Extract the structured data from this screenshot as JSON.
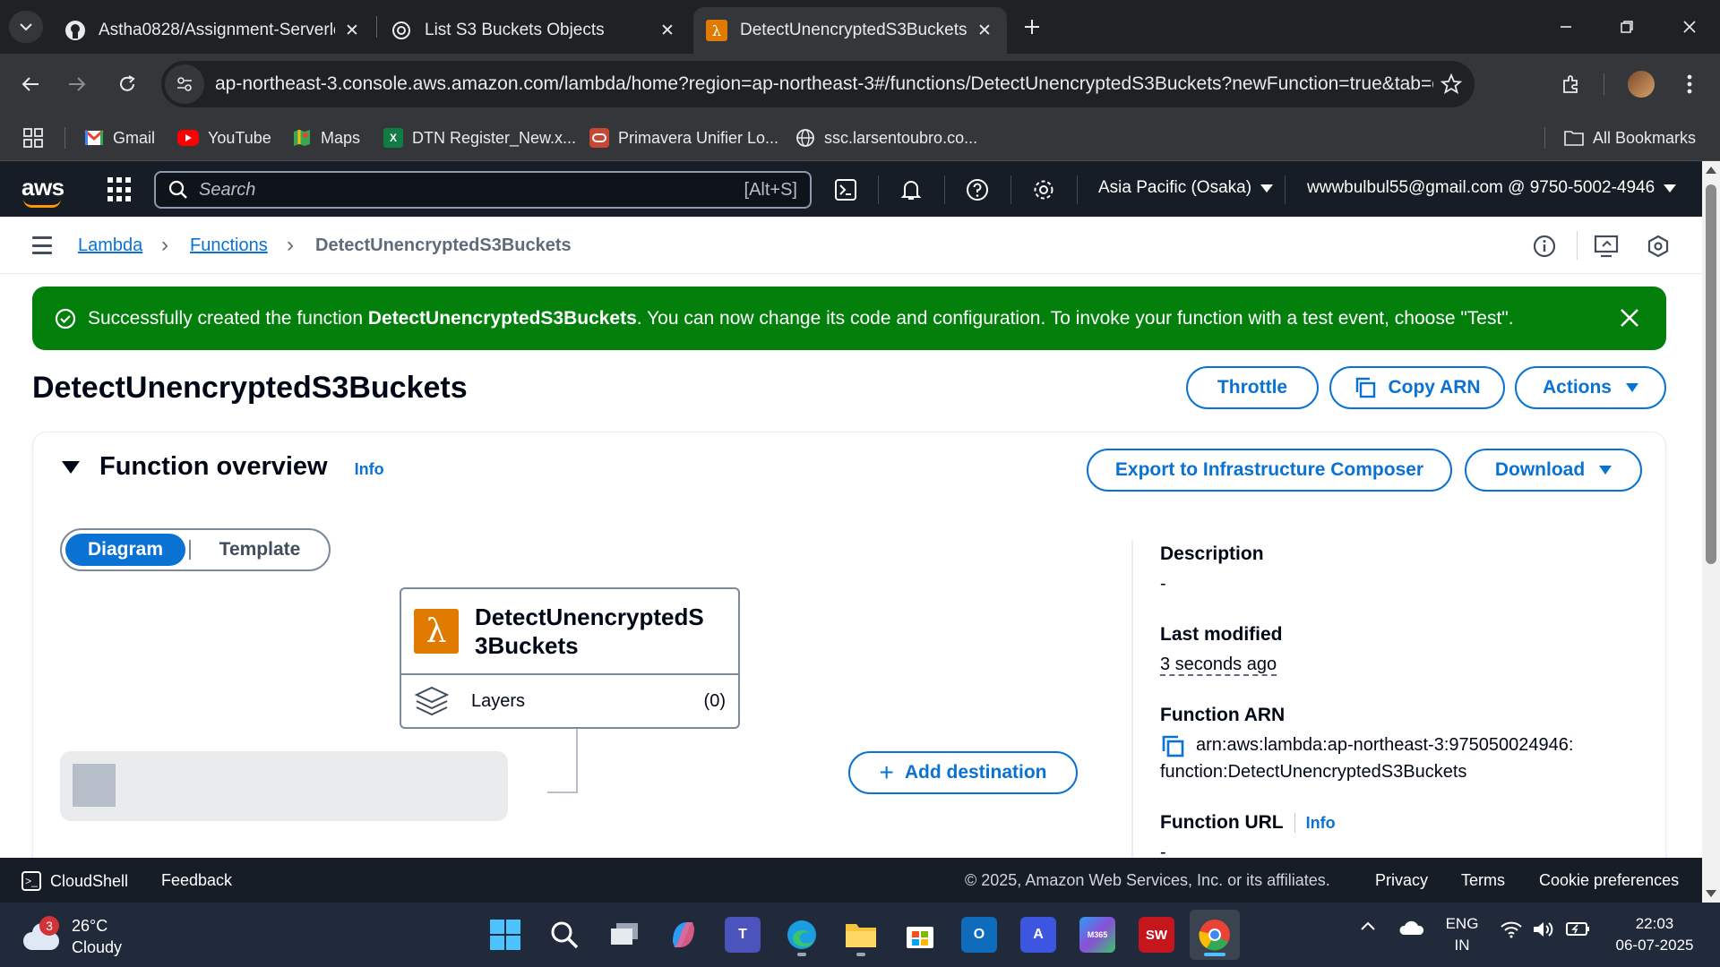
{
  "browser": {
    "tabs": [
      {
        "title": "Astha0828/Assignment-Serverle"
      },
      {
        "title": "List S3 Buckets Objects"
      },
      {
        "title": "DetectUnencryptedS3Buckets |"
      }
    ],
    "url": "ap-northeast-3.console.aws.amazon.com/lambda/home?region=ap-northeast-3#/functions/DetectUnencryptedS3Buckets?newFunction=true&tab=co...",
    "bookmarks": [
      {
        "label": "Gmail"
      },
      {
        "label": "YouTube"
      },
      {
        "label": "Maps"
      },
      {
        "label": "DTN Register_New.x..."
      },
      {
        "label": "Primavera Unifier Lo..."
      },
      {
        "label": "ssc.larsentoubro.co..."
      }
    ],
    "all_bookmarks": "All Bookmarks"
  },
  "aws": {
    "logo": "aws",
    "search_placeholder": "Search",
    "search_shortcut": "[Alt+S]",
    "region": "Asia Pacific (Osaka)",
    "account": "wwwbulbul55@gmail.com @ 9750-5002-4946"
  },
  "breadcrumb": {
    "items": [
      "Lambda",
      "Functions",
      "DetectUnencryptedS3Buckets"
    ]
  },
  "flash": {
    "prefix": "Successfully created the function ",
    "function_name": "DetectUnencryptedS3Buckets",
    "suffix": ". You can now change its code and configuration. To invoke your function with a test event, choose \"Test\"."
  },
  "page": {
    "title": "DetectUnencryptedS3Buckets",
    "buttons": {
      "throttle": "Throttle",
      "copy_arn": "Copy ARN",
      "actions": "Actions"
    }
  },
  "overview": {
    "title": "Function overview",
    "info": "Info",
    "export_button": "Export to Infrastructure Composer",
    "download_button": "Download",
    "segments": {
      "diagram": "Diagram",
      "template": "Template"
    },
    "function_card": {
      "name": "DetectUnencryptedS3Buckets",
      "layers_label": "Layers",
      "layers_count": "(0)"
    },
    "add_destination": "Add destination",
    "details": {
      "description_label": "Description",
      "description_value": "-",
      "last_modified_label": "Last modified",
      "last_modified_value": "3 seconds ago",
      "arn_label": "Function ARN",
      "arn_line1": "arn:aws:lambda:ap-northeast-3:975050024946:",
      "arn_line2": "function:DetectUnencryptedS3Buckets",
      "url_label": "Function URL",
      "url_info": "Info",
      "url_value": "-"
    }
  },
  "footer": {
    "cloudshell": "CloudShell",
    "feedback": "Feedback",
    "copyright": "© 2025, Amazon Web Services, Inc. or its affiliates.",
    "privacy": "Privacy",
    "terms": "Terms",
    "cookies": "Cookie preferences"
  },
  "taskbar": {
    "weather_badge": "3",
    "temperature": "26°C",
    "condition": "Cloudy",
    "lang1": "ENG",
    "lang2": "IN",
    "time": "22:03",
    "date": "06-07-2025",
    "apps": [
      {
        "icon": "windows-start-icon"
      },
      {
        "icon": "search-icon"
      },
      {
        "icon": "task-view-icon"
      },
      {
        "icon": "copilot-icon"
      },
      {
        "icon": "teams-icon"
      },
      {
        "icon": "edge-icon"
      },
      {
        "icon": "file-explorer-icon"
      },
      {
        "icon": "microsoft-store-icon"
      },
      {
        "icon": "outlook-icon"
      },
      {
        "icon": "autocad-icon"
      },
      {
        "icon": "m365-icon"
      },
      {
        "icon": "solidworks-icon"
      },
      {
        "icon": "chrome-icon"
      }
    ]
  },
  "colors": {
    "aws_dark": "#161d26",
    "primary_blue": "#0972d3",
    "success_green": "#037f0c",
    "lambda_orange": "#e07b00"
  }
}
